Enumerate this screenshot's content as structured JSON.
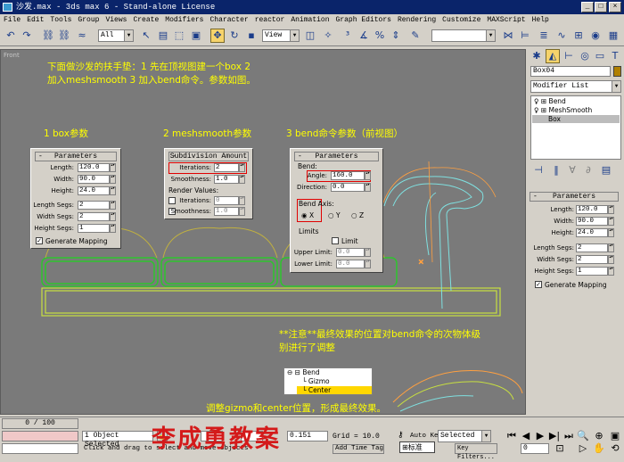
{
  "window": {
    "title": "沙发.max - 3ds max 6 - Stand-alone License"
  },
  "menu": [
    "File",
    "Edit",
    "Tools",
    "Group",
    "Views",
    "Create",
    "Modifiers",
    "Character",
    "reactor",
    "Animation",
    "Graph Editors",
    "Rendering",
    "Customize",
    "MAXScript",
    "Help"
  ],
  "toolbar": {
    "selection_filter": "All",
    "coord_system": "View"
  },
  "viewport": {
    "label": "Front",
    "intro_line1": "下面做沙发的扶手垫：1 先在顶视图建一个box   2",
    "intro_line2": "加入meshsmooth    3 加入bend命令。参数如图。",
    "step1_title": "1   box参数",
    "step2_title": "2 meshsmooth参数",
    "step3_title": "3 bend命令参数（前视图）",
    "note_line1": "**注意**最终效果的位置对bend命令的次物体级",
    "note_line2": "别进行了调整",
    "final_text": "调整gizmo和center位置，形成最终效果。",
    "watermark": "李成勇教案"
  },
  "box_params": {
    "header": "Parameters",
    "length_label": "Length:",
    "length": "120.0",
    "width_label": "Width:",
    "width": "90.0",
    "height_label": "Height:",
    "height": "24.0",
    "lsegs_label": "Length Segs:",
    "lsegs": "2",
    "wsegs_label": "Width Segs:",
    "wsegs": "2",
    "hsegs_label": "Height Segs:",
    "hsegs": "1",
    "genmap": "Generate Mapping"
  },
  "meshsmooth": {
    "header": "Subdivision Amount",
    "iter_label": "Iterations:",
    "iter": "2",
    "smooth_label": "Smoothness:",
    "smooth": "1.0",
    "render_values": "Render Values:",
    "r_iter_label": "Iterations:",
    "r_iter": "0",
    "r_smooth_label": "Smoothness:",
    "r_smooth": "1.0"
  },
  "bend": {
    "header": "Parameters",
    "bend_group": "Bend:",
    "angle_label": "Angle:",
    "angle": "160.0",
    "dir_label": "Direction:",
    "dir": "0.0",
    "axis_group": "Bend Axis:",
    "axis_x": "X",
    "axis_y": "Y",
    "axis_z": "Z",
    "limits_group": "Limits",
    "limit_label": "Limit",
    "upper_label": "Upper Limit:",
    "upper": "0.0",
    "lower_label": "Lower Limit:",
    "lower": "0.0"
  },
  "subobj_tree": [
    "Bend",
    "Gizmo",
    "Center"
  ],
  "cmd": {
    "object_name": "Box04",
    "modifier_list": "Modifier List",
    "stack": [
      "Bend",
      "MeshSmooth",
      "Box"
    ],
    "header": "Parameters",
    "length_label": "Length:",
    "length": "120.0",
    "width_label": "Width:",
    "width": "90.0",
    "height_label": "Height:",
    "height": "24.0",
    "lsegs_label": "Length Segs:",
    "lsegs": "2",
    "wsegs_label": "Width Segs:",
    "wsegs": "2",
    "hsegs_label": "Height Segs:",
    "hsegs": "1",
    "genmap": "Generate Mapping"
  },
  "status": {
    "time": "0 / 100",
    "selected": "1 Object Selected",
    "prompt": "Click and drag to select and move objects",
    "z_value": "0.151",
    "grid": "Grid = 10.0",
    "add_time_tag": "Add Time Tag",
    "auto_key": "Auto Key",
    "set_key_combo": "Selected",
    "key_filters": "Key Filters...",
    "frame": "0",
    "lang_btn": "标准"
  },
  "colors": {
    "title_bg": "#0a246a",
    "viewport_bg": "#7a7a7a",
    "annotation": "#ffff00",
    "highlight": "#e00000",
    "selection_bar": "#ffd700",
    "watermark": "#d41a1a",
    "model_green": "#c8e040",
    "model_cyan": "#7fe0e0",
    "model_orange": "#ffa040"
  }
}
